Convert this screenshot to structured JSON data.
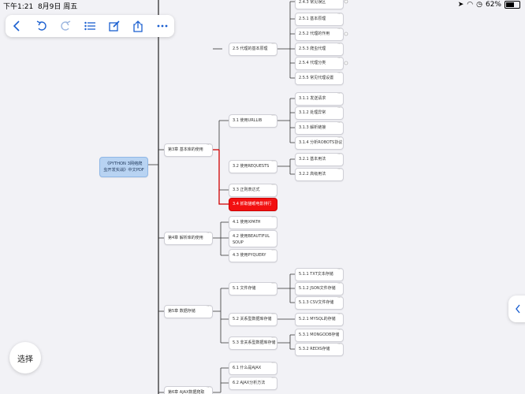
{
  "status_bar": {
    "time": "下午1:21",
    "date": "8月9日 周五",
    "battery_percent": "62%",
    "battery_level": 0.62
  },
  "toolbar": {
    "icons": [
      "back-icon",
      "undo-icon",
      "redo-icon",
      "outline-list-icon",
      "edit-icon",
      "share-icon",
      "more-icon"
    ]
  },
  "select_button": {
    "label": "选择"
  },
  "colors": {
    "accent": "#1a5fd0",
    "selected_node": "#f21010",
    "root_node": "#b8d3f2"
  },
  "mindmap": {
    "root": "《PYTHON 3网络爬虫开发实战》中文PDF",
    "chapters": [
      {
        "id": "ch3",
        "label": "第3章 基本库的使用"
      },
      {
        "id": "ch4",
        "label": "第4章 解析库的使用"
      },
      {
        "id": "ch5",
        "label": "第5章 数据存储"
      },
      {
        "id": "ch6",
        "label": "第6章 AJAX数据爬取"
      }
    ],
    "sections": [
      {
        "id": "s25",
        "label": "2.5 代理的基本原理"
      },
      {
        "id": "s31",
        "label": "3.1 使用URLLIB"
      },
      {
        "id": "s32",
        "label": "3.2 使用REQUESTS"
      },
      {
        "id": "s33",
        "label": "3.3 正则表达式"
      },
      {
        "id": "s34",
        "label": "3.4 抓取猫眼电影排行"
      },
      {
        "id": "s41",
        "label": "4.1 使用XPATH"
      },
      {
        "id": "s42",
        "label": "4.2 使用BEAUTIFUL SOUP"
      },
      {
        "id": "s43",
        "label": "4.3 使用PYQUERY"
      },
      {
        "id": "s51",
        "label": "5.1 文件存储"
      },
      {
        "id": "s52",
        "label": "5.2 关系型数据库存储"
      },
      {
        "id": "s53",
        "label": "5.3 非关系型数据库存储"
      },
      {
        "id": "s61",
        "label": "6.1 什么是AJAX"
      },
      {
        "id": "s62",
        "label": "6.2 AJAX分析方法"
      }
    ],
    "leaves": [
      {
        "id": "l243",
        "label": "2.4.3 常见误区"
      },
      {
        "id": "l251",
        "label": "2.5.1 基本原理"
      },
      {
        "id": "l252",
        "label": "2.5.2 代理的作用"
      },
      {
        "id": "l253",
        "label": "2.5.3 爬虫代理"
      },
      {
        "id": "l254",
        "label": "2.5.4 代理分类"
      },
      {
        "id": "l255",
        "label": "2.5.5 常见代理设置"
      },
      {
        "id": "l311",
        "label": "3.1.1 发送请求"
      },
      {
        "id": "l312",
        "label": "3.1.2 处理异常"
      },
      {
        "id": "l313",
        "label": "3.1.3 解析链接"
      },
      {
        "id": "l314",
        "label": "3.1.4 分析ROBOTS协议"
      },
      {
        "id": "l321",
        "label": "3.2.1 基本用法"
      },
      {
        "id": "l322",
        "label": "3.2.2 高级用法"
      },
      {
        "id": "l511",
        "label": "5.1.1 TXT文本存储"
      },
      {
        "id": "l512",
        "label": "5.1.2 JSON文件存储"
      },
      {
        "id": "l513",
        "label": "5.1.3 CSV文件存储"
      },
      {
        "id": "l521",
        "label": "5.2.1 MYSQL的存储"
      },
      {
        "id": "l531",
        "label": "5.3.1 MONGODB存储"
      },
      {
        "id": "l532",
        "label": "5.3.2 REDIS存储"
      }
    ]
  }
}
